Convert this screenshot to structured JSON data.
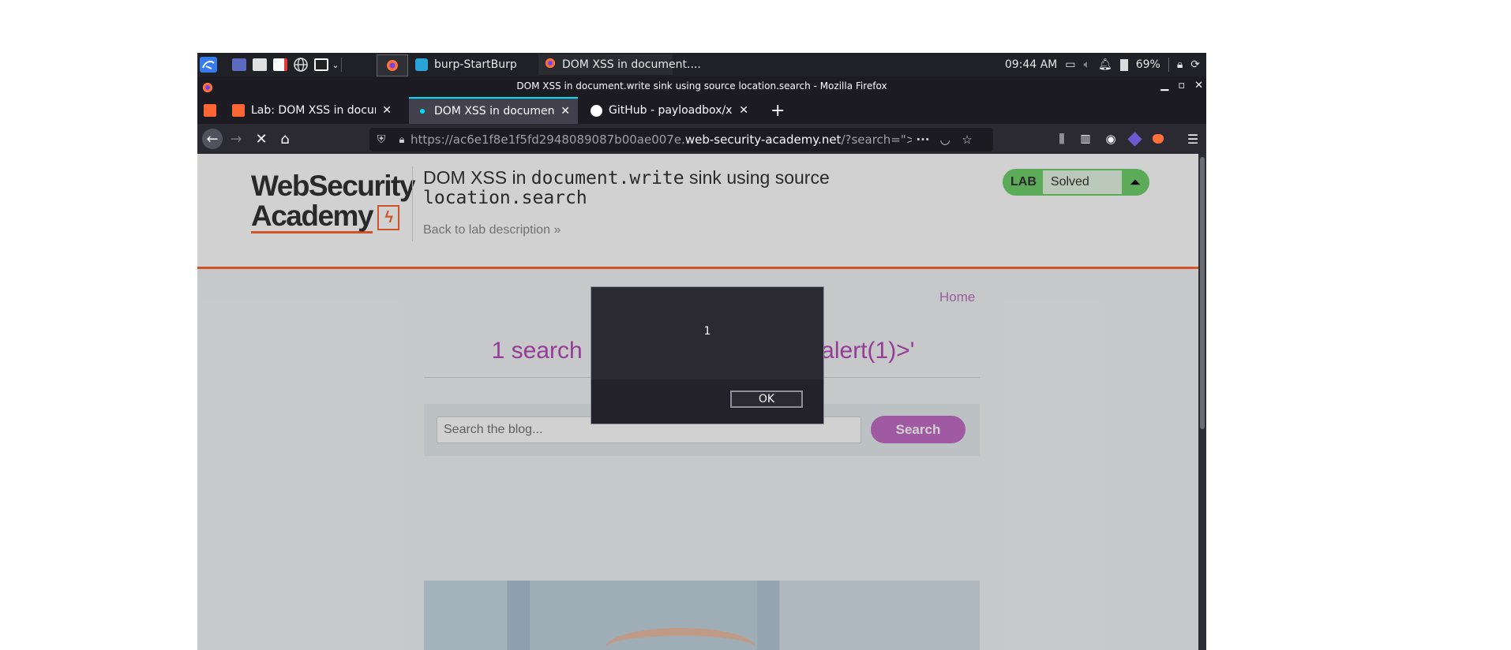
{
  "taskbar": {
    "tasks": [
      {
        "label": "burp-StartBurp",
        "icon": "burp-icon"
      },
      {
        "label": "DOM XSS in document....",
        "icon": "firefox-icon"
      }
    ],
    "clock": "09:44 AM",
    "battery": "69%"
  },
  "window": {
    "title": "DOM XSS in document.write sink using source location.search - Mozilla Firefox"
  },
  "browser": {
    "tabs": [
      {
        "label": "Lab: DOM XSS in docume",
        "active": false
      },
      {
        "label": "DOM XSS in document.w",
        "active": true
      },
      {
        "label": "GitHub - payloadbox/xss",
        "active": false
      }
    ],
    "url": {
      "prefix": "https://ac6e1f8e1f5fd2948089087b00ae007e.",
      "domain": "web-security-academy.net",
      "suffix": "/?search=\"><svg"
    }
  },
  "page": {
    "logo_line1": "WebSecurity",
    "logo_line2": "Academy",
    "title_pre": "DOM XSS in ",
    "title_code1": "document.write",
    "title_mid": " sink using source",
    "title_code2": "location.search",
    "back_link": "Back to lab description",
    "lab_badge": "LAB",
    "lab_status": "Solved",
    "home": "Home",
    "results_left": "1 search re",
    "results_right": "=alert(1)>'",
    "search_placeholder": "Search the blog...",
    "search_button": "Search"
  },
  "alert": {
    "message": "1",
    "ok": "OK"
  },
  "colors": {
    "accent_tab": "#00ddff",
    "academy_orange": "#ff6633",
    "lab_green": "#70d16d",
    "purple": "#c26ec6"
  }
}
